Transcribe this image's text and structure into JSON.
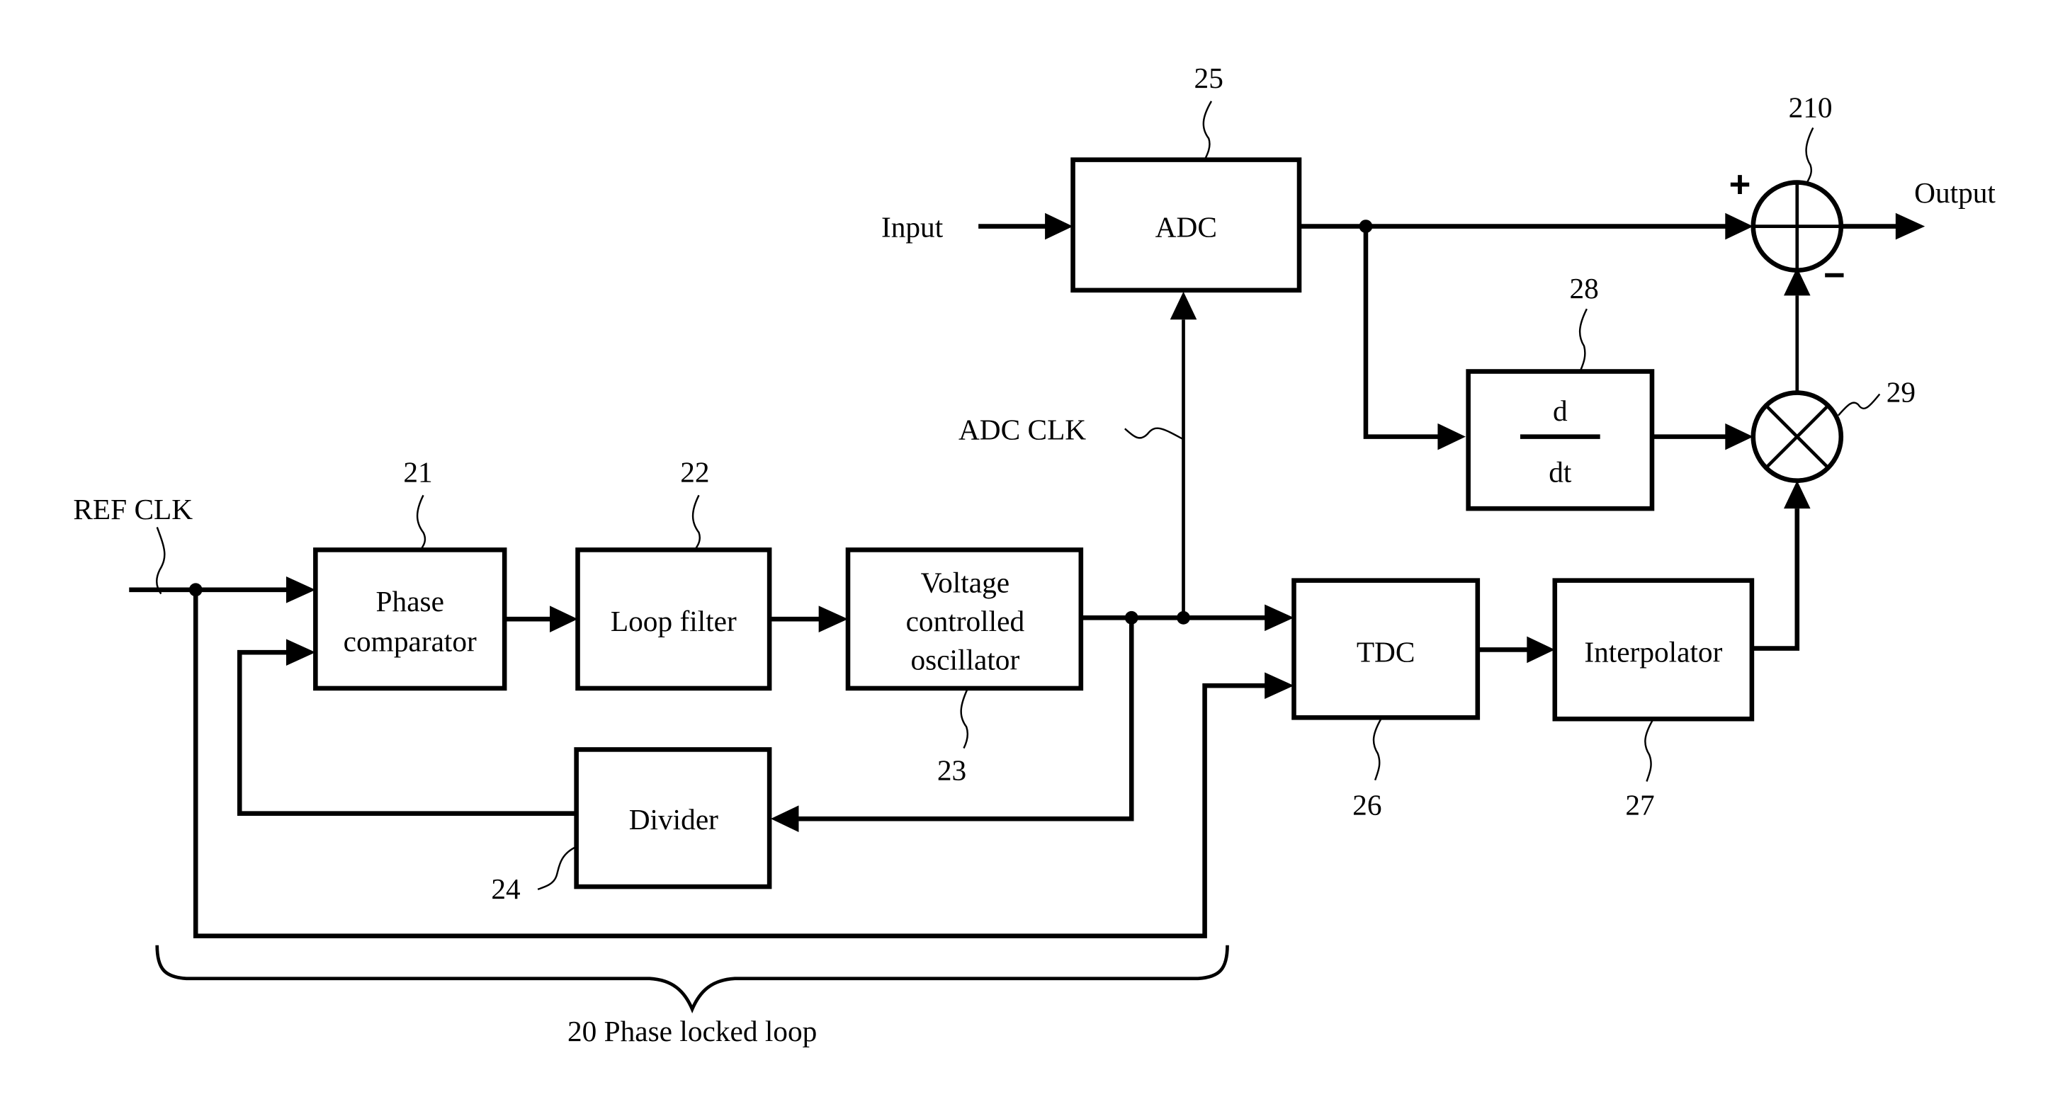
{
  "figure": {
    "signals": {
      "ref_clk": "REF CLK",
      "input": "Input",
      "adc_clk": "ADC CLK",
      "output": "Output"
    },
    "blocks": {
      "phase_comparator": {
        "line1": "Phase",
        "line2": "comparator",
        "ref": "21"
      },
      "loop_filter": {
        "label": "Loop filter",
        "ref": "22"
      },
      "vco": {
        "line1": "Voltage",
        "line2": "controlled",
        "line3": "oscillator",
        "ref": "23"
      },
      "divider": {
        "label": "Divider",
        "ref": "24"
      },
      "adc": {
        "label": "ADC",
        "ref": "25"
      },
      "tdc": {
        "label": "TDC",
        "ref": "26"
      },
      "interpolator": {
        "label": "Interpolator",
        "ref": "27"
      },
      "differentiator": {
        "numerator": "d",
        "denominator": "dt",
        "ref": "28"
      },
      "multiplier": {
        "ref": "29"
      },
      "adder": {
        "ref": "210",
        "plus": "+",
        "minus": "−"
      }
    },
    "group": {
      "pll_label": "20 Phase locked loop"
    }
  }
}
